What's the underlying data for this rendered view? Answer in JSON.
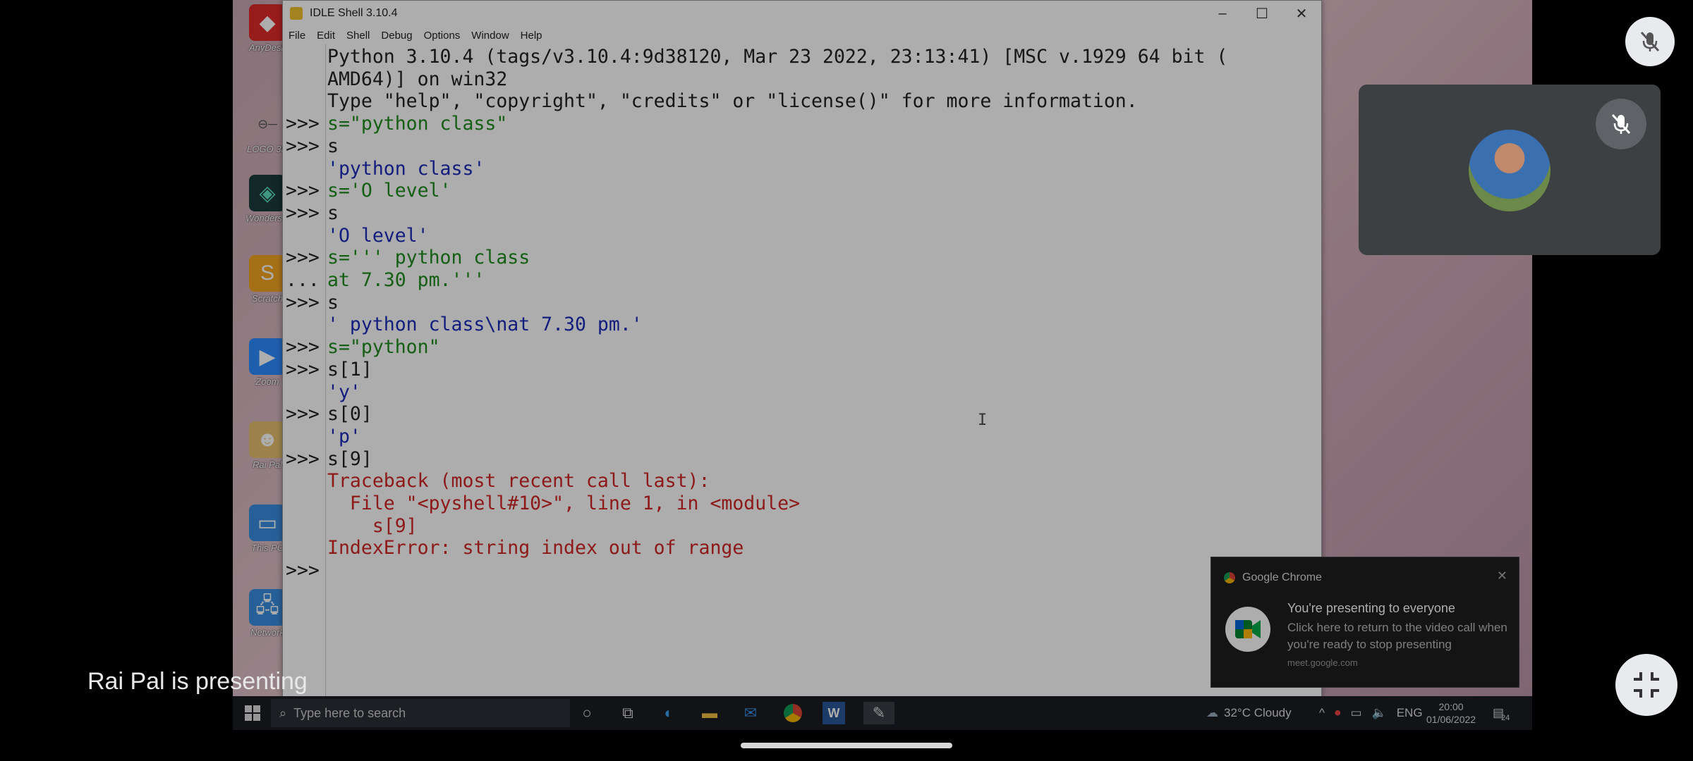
{
  "idle": {
    "title": "IDLE Shell 3.10.4",
    "menu": [
      "File",
      "Edit",
      "Shell",
      "Debug",
      "Options",
      "Window",
      "Help"
    ],
    "lines": [
      {
        "prompt": "",
        "text": "Python 3.10.4 (tags/v3.10.4:9d38120, Mar 23 2022, 23:13:41) [MSC v.1929 64 bit (",
        "color": "black"
      },
      {
        "prompt": "",
        "text": "AMD64)] on win32",
        "color": "black"
      },
      {
        "prompt": "",
        "text": "Type \"help\", \"copyright\", \"credits\" or \"license()\" for more information.",
        "color": "black"
      },
      {
        "prompt": ">>>",
        "text": "s=\"python class\"",
        "color": "green"
      },
      {
        "prompt": ">>>",
        "text": "s",
        "color": "black"
      },
      {
        "prompt": "",
        "text": "'python class'",
        "color": "blue"
      },
      {
        "prompt": ">>>",
        "text": "s='O level'",
        "color": "green"
      },
      {
        "prompt": ">>>",
        "text": "s",
        "color": "black"
      },
      {
        "prompt": "",
        "text": "'O level'",
        "color": "blue"
      },
      {
        "prompt": ">>>",
        "text": "s=''' python class",
        "color": "green"
      },
      {
        "prompt": "...",
        "text": "at 7.30 pm.'''",
        "color": "green"
      },
      {
        "prompt": ">>>",
        "text": "s",
        "color": "black"
      },
      {
        "prompt": "",
        "text": "' python class\\nat 7.30 pm.'",
        "color": "blue"
      },
      {
        "prompt": ">>>",
        "text": "s=\"python\"",
        "color": "green"
      },
      {
        "prompt": ">>>",
        "text": "s[1]",
        "color": "black"
      },
      {
        "prompt": "",
        "text": "'y'",
        "color": "blue"
      },
      {
        "prompt": ">>>",
        "text": "s[0]",
        "color": "black"
      },
      {
        "prompt": "",
        "text": "'p'",
        "color": "blue"
      },
      {
        "prompt": ">>>",
        "text": "s[9]",
        "color": "black"
      },
      {
        "prompt": "",
        "text": "Traceback (most recent call last):",
        "color": "red"
      },
      {
        "prompt": "",
        "text": "  File \"<pyshell#10>\", line 1, in <module>",
        "color": "red"
      },
      {
        "prompt": "",
        "text": "    s[9]",
        "color": "red"
      },
      {
        "prompt": "",
        "text": "IndexError: string index out of range",
        "color": "red"
      },
      {
        "prompt": ">>>",
        "text": "",
        "color": "black"
      }
    ]
  },
  "desktop_icons": [
    "AnyDesk",
    "LOGO 3D",
    "Wondershare Filmora 11",
    "Scratch",
    "Zoom",
    "Rai Pal",
    "This PC",
    "Network"
  ],
  "notification": {
    "app": "Google Chrome",
    "title": "You're presenting to everyone",
    "body": "Click here to return to the video call when you're ready to stop presenting",
    "source": "meet.google.com"
  },
  "taskbar": {
    "search_placeholder": "Type here to search",
    "weather": "32°C  Cloudy",
    "language": "ENG",
    "time": "20:00",
    "date": "01/06/2022",
    "notification_count": "24"
  },
  "meet": {
    "presenter_label": "Rai Pal is presenting"
  },
  "colors": {
    "prompt_green": "#1e8c1e",
    "output_blue": "#1c2bb8",
    "error_red": "#d22525"
  }
}
